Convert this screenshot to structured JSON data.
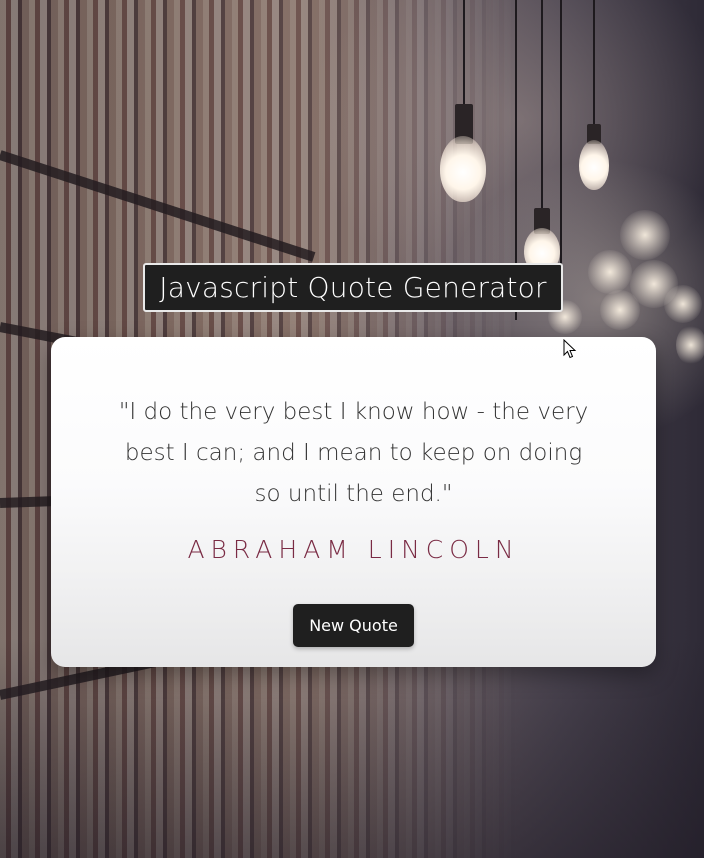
{
  "header": {
    "title": "Javascript Quote Generator"
  },
  "quote": {
    "text": "\"I do the very best I know how - the very best I can; and I mean to keep on doing so until the end.\"",
    "author": "ABRAHAM LINCOLN"
  },
  "actions": {
    "new_quote_label": "New Quote"
  },
  "background": {
    "scene": "library-bookshelves-with-hanging-bulbs-icon"
  },
  "colors": {
    "title_bg": "#1f1f1f",
    "card_bg": "#ffffff",
    "author": "#7a2b44",
    "button_bg": "#1f1f1f",
    "text": "#333333"
  },
  "icons": {
    "cursor": "mouse-pointer-icon"
  }
}
